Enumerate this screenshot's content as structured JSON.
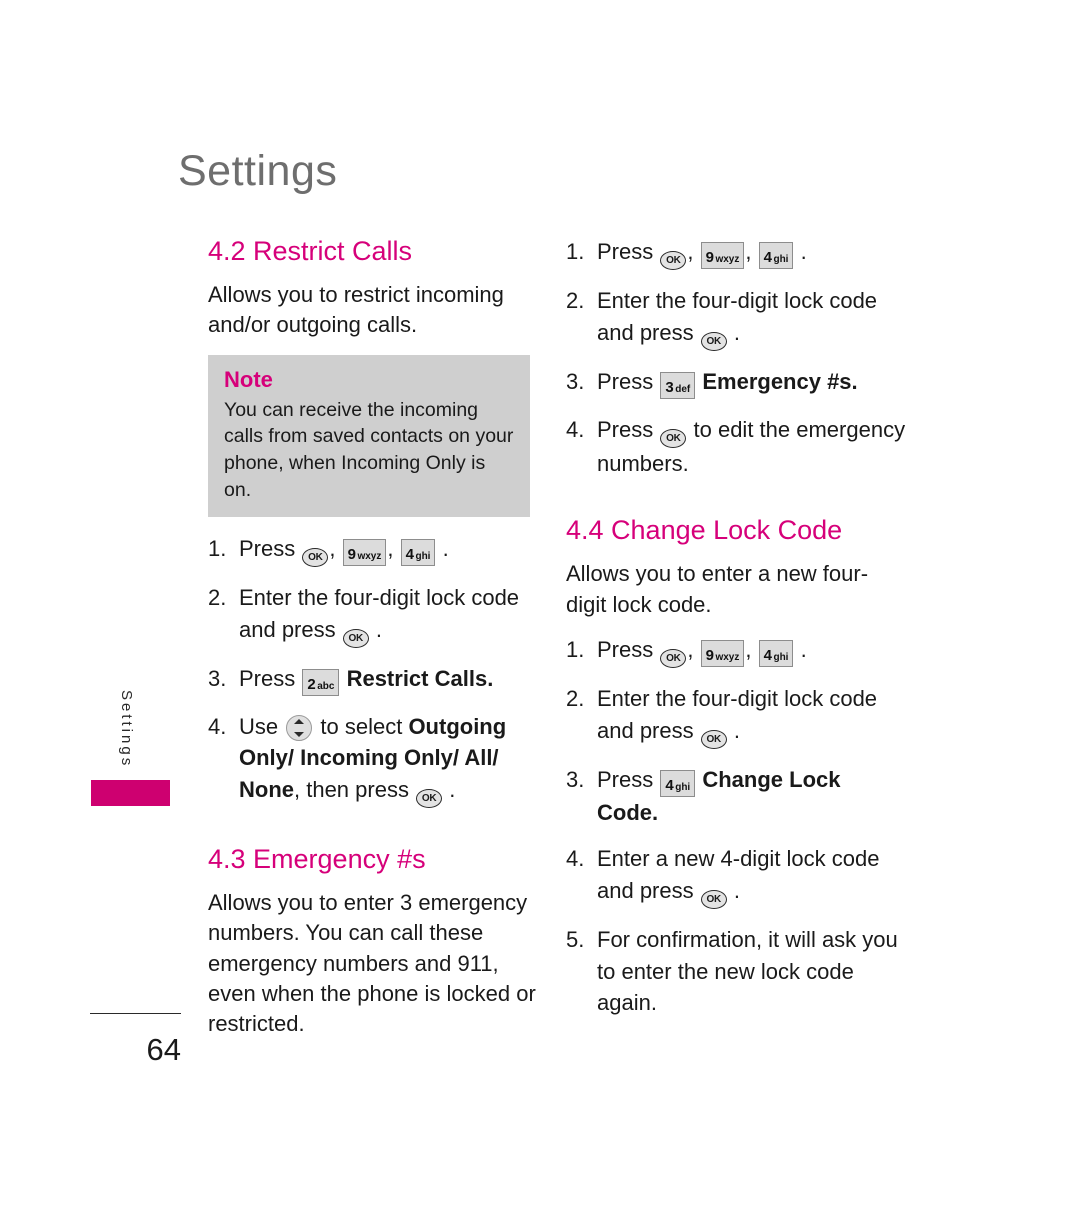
{
  "page": {
    "chapter_title": "Settings",
    "side_tab_label": "Settings",
    "page_number": "64",
    "accent_color": "#D6007A",
    "tab_color": "#CE0070",
    "note_bg_color": "#CFCFCF"
  },
  "icons": {
    "ok": {
      "name": "ok-key-icon",
      "label": "OK"
    },
    "key9": {
      "name": "key-9-wxyz-icon",
      "digit": "9",
      "letters": "wxyz"
    },
    "key4": {
      "name": "key-4-ghi-icon",
      "digit": "4",
      "letters": "ghi"
    },
    "key3": {
      "name": "key-3-def-icon",
      "digit": "3",
      "letters": "def"
    },
    "key2": {
      "name": "key-2-abc-icon",
      "digit": "2",
      "letters": "abc"
    },
    "nav": {
      "name": "navigation-updown-key-icon"
    }
  },
  "note": {
    "title": "Note",
    "body": "You can receive the incoming calls from saved contacts on your phone, when Incoming Only is on."
  },
  "sections": {
    "restrict_calls": {
      "heading": "4.2 Restrict Calls",
      "intro": "Allows you to restrict incoming and/or outgoing calls.",
      "steps": {
        "n1": "1.",
        "s1_press": "Press",
        "s1_comma1": ",",
        "s1_comma2": ",",
        "s1_period": ".",
        "n2": "2.",
        "s2_text": "Enter the four-digit lock code and press",
        "s2_period": ".",
        "n3": "3.",
        "s3_press": "Press",
        "s3_bold": "Restrict Calls.",
        "n4": "4.",
        "s4_use": "Use",
        "s4_mid": "to select",
        "s4_bold": "Outgoing Only/ Incoming Only/ All/ None",
        "s4_then": ", then press",
        "s4_period": "."
      }
    },
    "emergency_numbers": {
      "heading": "4.3 Emergency #s",
      "intro": "Allows you to enter 3 emergency numbers. You can call these emergency numbers and 911, even when the phone is locked or restricted."
    },
    "emergency_steps": {
      "n1": "1.",
      "s1_press": "Press",
      "s1_comma1": ",",
      "s1_comma2": ",",
      "s1_period": ".",
      "n2": "2.",
      "s2_text": "Enter the four-digit lock code and press",
      "s2_period": ".",
      "n3": "3.",
      "s3_press": "Press",
      "s3_bold": "Emergency #s.",
      "n4": "4.",
      "s4_press": "Press",
      "s4_text": "to edit the emergency numbers."
    },
    "change_lock_code": {
      "heading": "4.4 Change Lock Code",
      "intro": "Allows you to enter a new four-digit lock code.",
      "steps": {
        "n1": "1.",
        "s1_press": "Press",
        "s1_comma1": ",",
        "s1_comma2": ",",
        "s1_period": ".",
        "n2": "2.",
        "s2_text": "Enter the four-digit lock code and press",
        "s2_period": ".",
        "n3": "3.",
        "s3_press": "Press",
        "s3_bold": "Change Lock Code.",
        "n4": "4.",
        "s4_text": "Enter a new 4-digit lock code and press",
        "s4_period": ".",
        "n5": "5.",
        "s5_text": "For confirmation, it will ask you to enter the new lock code again."
      }
    }
  }
}
